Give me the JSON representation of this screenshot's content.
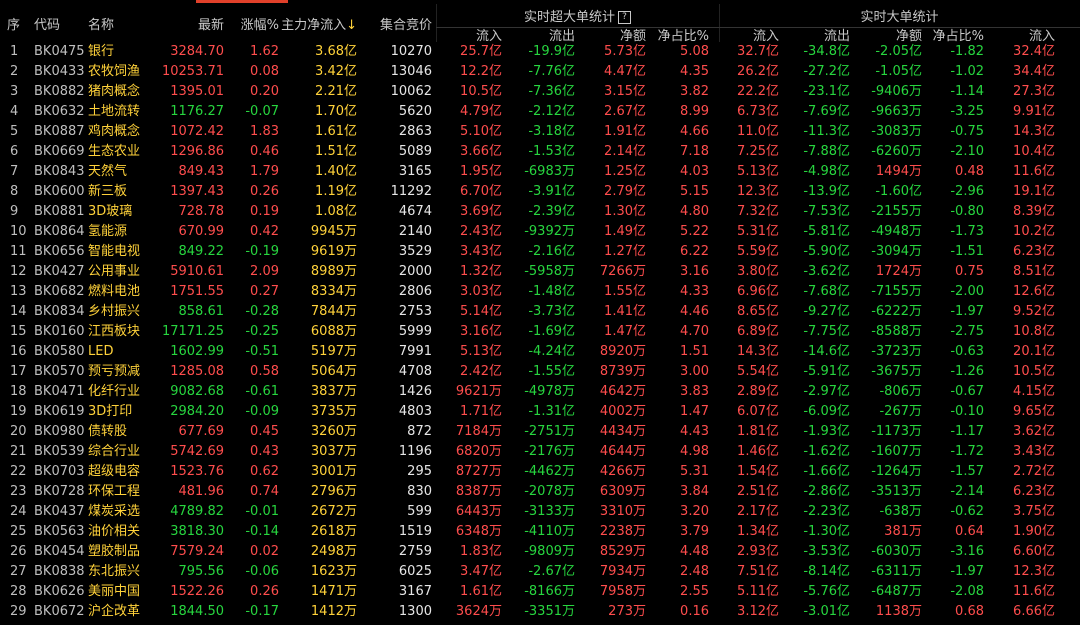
{
  "header": {
    "seq": "序",
    "code": "代码",
    "name": "名称",
    "latest": "最新",
    "change": "涨幅%",
    "main_net": "主力净流入",
    "sort_arrow": "↓",
    "auction": "集合竞价",
    "group1": "实时超大单统计",
    "group1_help": "?",
    "group2": "实时大单统计",
    "sub_in": "流入",
    "sub_out": "流出",
    "sub_net": "净额",
    "sub_ratio": "净占比%"
  },
  "colors": {
    "red": "#ff4d4d",
    "green": "#27d63f",
    "yellow": "#ffd23a",
    "accent": "#e0402a"
  },
  "rows": [
    [
      "1",
      "BK0475",
      "银行",
      "3284.70",
      "1.62",
      "3.68亿",
      "10270",
      "25.7亿",
      "-19.9亿",
      "5.73亿",
      "5.08",
      "32.7亿",
      "-34.8亿",
      "-2.05亿",
      "-1.82",
      "32.4亿"
    ],
    [
      "2",
      "BK0433",
      "农牧饲渔",
      "10253.71",
      "0.08",
      "3.42亿",
      "13046",
      "12.2亿",
      "-7.76亿",
      "4.47亿",
      "4.35",
      "26.2亿",
      "-27.2亿",
      "-1.05亿",
      "-1.02",
      "34.4亿"
    ],
    [
      "3",
      "BK0882",
      "猪肉概念",
      "1395.01",
      "0.20",
      "2.21亿",
      "10062",
      "10.5亿",
      "-7.36亿",
      "3.15亿",
      "3.82",
      "22.2亿",
      "-23.1亿",
      "-9406万",
      "-1.14",
      "27.3亿"
    ],
    [
      "4",
      "BK0632",
      "土地流转",
      "1176.27",
      "-0.07",
      "1.70亿",
      "5620",
      "4.79亿",
      "-2.12亿",
      "2.67亿",
      "8.99",
      "6.73亿",
      "-7.69亿",
      "-9663万",
      "-3.25",
      "9.91亿"
    ],
    [
      "5",
      "BK0887",
      "鸡肉概念",
      "1072.42",
      "1.83",
      "1.61亿",
      "2863",
      "5.10亿",
      "-3.18亿",
      "1.91亿",
      "4.66",
      "11.0亿",
      "-11.3亿",
      "-3083万",
      "-0.75",
      "14.3亿"
    ],
    [
      "6",
      "BK0669",
      "生态农业",
      "1296.86",
      "0.46",
      "1.51亿",
      "5089",
      "3.66亿",
      "-1.53亿",
      "2.14亿",
      "7.18",
      "7.25亿",
      "-7.88亿",
      "-6260万",
      "-2.10",
      "10.4亿"
    ],
    [
      "7",
      "BK0843",
      "天然气",
      "849.43",
      "1.79",
      "1.40亿",
      "3165",
      "1.95亿",
      "-6983万",
      "1.25亿",
      "4.03",
      "5.13亿",
      "-4.98亿",
      "1494万",
      "0.48",
      "11.6亿"
    ],
    [
      "8",
      "BK0600",
      "新三板",
      "1397.43",
      "0.26",
      "1.19亿",
      "11292",
      "6.70亿",
      "-3.91亿",
      "2.79亿",
      "5.15",
      "12.3亿",
      "-13.9亿",
      "-1.60亿",
      "-2.96",
      "19.1亿"
    ],
    [
      "9",
      "BK0881",
      "3D玻璃",
      "728.78",
      "0.19",
      "1.08亿",
      "4674",
      "3.69亿",
      "-2.39亿",
      "1.30亿",
      "4.80",
      "7.32亿",
      "-7.53亿",
      "-2155万",
      "-0.80",
      "8.39亿"
    ],
    [
      "10",
      "BK0864",
      "氢能源",
      "670.99",
      "0.42",
      "9945万",
      "2140",
      "2.43亿",
      "-9392万",
      "1.49亿",
      "5.22",
      "5.31亿",
      "-5.81亿",
      "-4948万",
      "-1.73",
      "10.2亿"
    ],
    [
      "11",
      "BK0656",
      "智能电视",
      "849.22",
      "-0.19",
      "9619万",
      "3529",
      "3.43亿",
      "-2.16亿",
      "1.27亿",
      "6.22",
      "5.59亿",
      "-5.90亿",
      "-3094万",
      "-1.51",
      "6.23亿"
    ],
    [
      "12",
      "BK0427",
      "公用事业",
      "5910.61",
      "2.09",
      "8989万",
      "2000",
      "1.32亿",
      "-5958万",
      "7266万",
      "3.16",
      "3.80亿",
      "-3.62亿",
      "1724万",
      "0.75",
      "8.51亿"
    ],
    [
      "13",
      "BK0682",
      "燃料电池",
      "1751.55",
      "0.27",
      "8334万",
      "2806",
      "3.03亿",
      "-1.48亿",
      "1.55亿",
      "4.33",
      "6.96亿",
      "-7.68亿",
      "-7155万",
      "-2.00",
      "12.6亿"
    ],
    [
      "14",
      "BK0834",
      "乡村振兴",
      "858.61",
      "-0.28",
      "7844万",
      "2753",
      "5.14亿",
      "-3.73亿",
      "1.41亿",
      "4.46",
      "8.65亿",
      "-9.27亿",
      "-6222万",
      "-1.97",
      "9.52亿"
    ],
    [
      "15",
      "BK0160",
      "江西板块",
      "17171.25",
      "-0.25",
      "6088万",
      "5999",
      "3.16亿",
      "-1.69亿",
      "1.47亿",
      "4.70",
      "6.89亿",
      "-7.75亿",
      "-8588万",
      "-2.75",
      "10.8亿"
    ],
    [
      "16",
      "BK0580",
      "LED",
      "1602.99",
      "-0.51",
      "5197万",
      "7991",
      "5.13亿",
      "-4.24亿",
      "8920万",
      "1.51",
      "14.3亿",
      "-14.6亿",
      "-3723万",
      "-0.63",
      "20.1亿"
    ],
    [
      "17",
      "BK0570",
      "预亏预减",
      "1285.08",
      "0.58",
      "5064万",
      "4708",
      "2.42亿",
      "-1.55亿",
      "8739万",
      "3.00",
      "5.54亿",
      "-5.91亿",
      "-3675万",
      "-1.26",
      "10.5亿"
    ],
    [
      "18",
      "BK0471",
      "化纤行业",
      "9082.68",
      "-0.61",
      "3837万",
      "1426",
      "9621万",
      "-4978万",
      "4642万",
      "3.83",
      "2.89亿",
      "-2.97亿",
      "-806万",
      "-0.67",
      "4.15亿"
    ],
    [
      "19",
      "BK0619",
      "3D打印",
      "2984.20",
      "-0.09",
      "3735万",
      "4803",
      "1.71亿",
      "-1.31亿",
      "4002万",
      "1.47",
      "6.07亿",
      "-6.09亿",
      "-267万",
      "-0.10",
      "9.65亿"
    ],
    [
      "20",
      "BK0980",
      "债转股",
      "677.69",
      "0.45",
      "3260万",
      "872",
      "7184万",
      "-2751万",
      "4434万",
      "4.43",
      "1.81亿",
      "-1.93亿",
      "-1173万",
      "-1.17",
      "3.62亿"
    ],
    [
      "21",
      "BK0539",
      "综合行业",
      "5742.69",
      "0.43",
      "3037万",
      "1196",
      "6820万",
      "-2176万",
      "4644万",
      "4.98",
      "1.46亿",
      "-1.62亿",
      "-1607万",
      "-1.72",
      "3.43亿"
    ],
    [
      "22",
      "BK0703",
      "超级电容",
      "1523.76",
      "0.62",
      "3001万",
      "295",
      "8727万",
      "-4462万",
      "4266万",
      "5.31",
      "1.54亿",
      "-1.66亿",
      "-1264万",
      "-1.57",
      "2.72亿"
    ],
    [
      "23",
      "BK0728",
      "环保工程",
      "481.96",
      "0.74",
      "2796万",
      "830",
      "8387万",
      "-2078万",
      "6309万",
      "3.84",
      "2.51亿",
      "-2.86亿",
      "-3513万",
      "-2.14",
      "6.23亿"
    ],
    [
      "24",
      "BK0437",
      "煤炭采选",
      "4789.82",
      "-0.01",
      "2672万",
      "599",
      "6443万",
      "-3133万",
      "3310万",
      "3.20",
      "2.17亿",
      "-2.23亿",
      "-638万",
      "-0.62",
      "3.75亿"
    ],
    [
      "25",
      "BK0563",
      "油价相关",
      "3818.30",
      "-0.14",
      "2618万",
      "1519",
      "6348万",
      "-4110万",
      "2238万",
      "3.79",
      "1.34亿",
      "-1.30亿",
      "381万",
      "0.64",
      "1.90亿"
    ],
    [
      "26",
      "BK0454",
      "塑胶制品",
      "7579.24",
      "0.02",
      "2498万",
      "2759",
      "1.83亿",
      "-9809万",
      "8529万",
      "4.48",
      "2.93亿",
      "-3.53亿",
      "-6030万",
      "-3.16",
      "6.60亿"
    ],
    [
      "27",
      "BK0838",
      "东北振兴",
      "795.56",
      "-0.06",
      "1623万",
      "6025",
      "3.47亿",
      "-2.67亿",
      "7934万",
      "2.48",
      "7.51亿",
      "-8.14亿",
      "-6311万",
      "-1.97",
      "12.3亿"
    ],
    [
      "28",
      "BK0626",
      "美丽中国",
      "1522.26",
      "0.26",
      "1471万",
      "3167",
      "1.61亿",
      "-8166万",
      "7958万",
      "2.55",
      "5.11亿",
      "-5.76亿",
      "-6487万",
      "-2.08",
      "11.6亿"
    ],
    [
      "29",
      "BK0672",
      "沪企改革",
      "1844.50",
      "-0.17",
      "1412万",
      "1300",
      "3624万",
      "-3351万",
      "273万",
      "0.16",
      "3.12亿",
      "-3.01亿",
      "1138万",
      "0.68",
      "6.66亿"
    ]
  ]
}
